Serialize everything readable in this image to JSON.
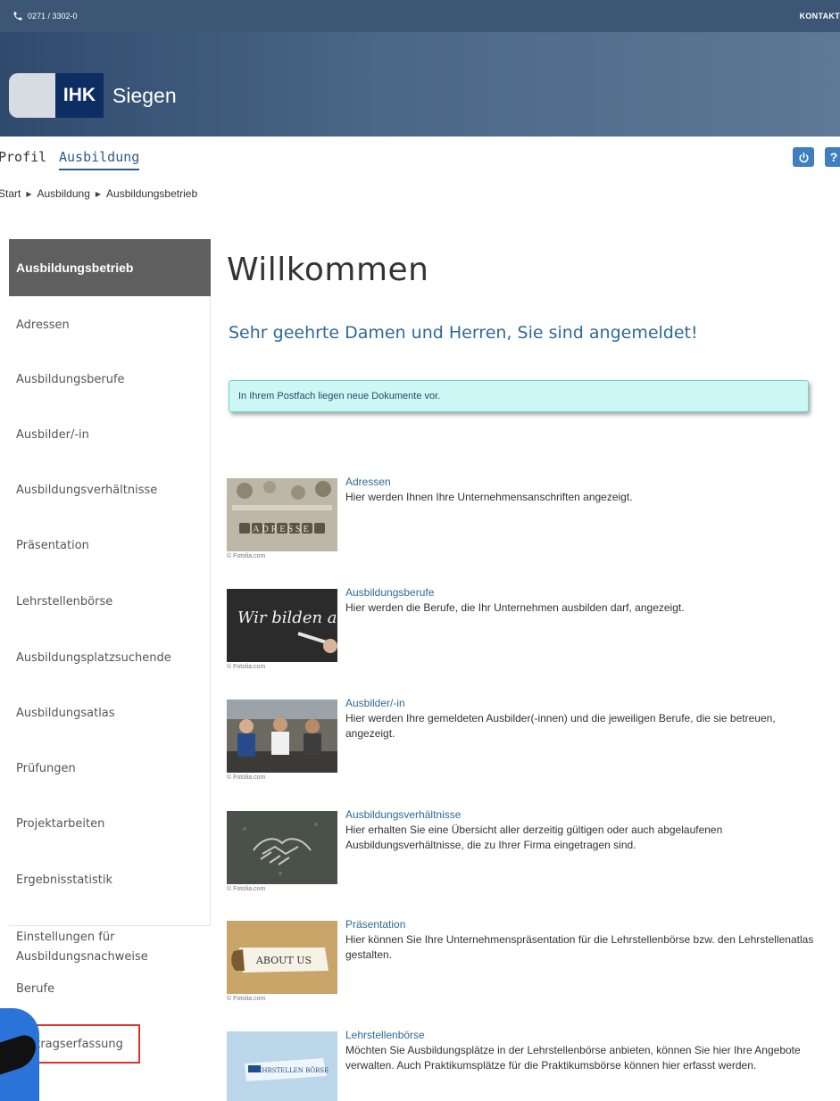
{
  "topbar": {
    "phone": "0271 / 3302-0",
    "contact": "KONTAKT"
  },
  "logo": {
    "abbr": "IHK",
    "city": "Siegen"
  },
  "nav": {
    "tabs": [
      "Profil",
      "Ausbildung"
    ],
    "power_icon": "power-icon",
    "help_label": "?"
  },
  "breadcrumb": [
    "Start",
    "Ausbildung",
    "Ausbildungsbetrieb"
  ],
  "sidebar": {
    "items": [
      "Ausbildungsbetrieb",
      "Adressen",
      "Ausbildungsberufe",
      "Ausbilder/-in",
      "Ausbildungsverhältnisse",
      "Präsentation",
      "Lehrstellenbörse",
      "Ausbildungsplatzsuchende",
      "Ausbildungsatlas",
      "Prüfungen",
      "Projektarbeiten",
      "Ergebnisstatistik",
      "Einstellungen für Ausbildungsnachweise",
      "Berufe",
      "Vertragserfassung"
    ]
  },
  "main": {
    "title": "Willkommen",
    "greeting": "Sehr geehrte Damen und Herren, Sie sind angemeldet!",
    "alert": "In Ihrem Postfach liegen neue Dokumente vor.",
    "credit": "© Fotolia.com",
    "cards": [
      {
        "title": "Adressen",
        "desc": "Hier werden Ihnen Ihre Unternehmensanschriften angezeigt.",
        "thumb_text": "ADRESSE"
      },
      {
        "title": "Ausbildungsberufe",
        "desc": "Hier werden die Berufe, die Ihr Unternehmen ausbilden darf, angezeigt.",
        "thumb_text": "Wir bilden aus!"
      },
      {
        "title": "Ausbilder/-in",
        "desc": "Hier werden Ihre gemeldeten Ausbilder(-innen) und die jeweiligen Berufe, die sie betreuen, angezeigt.",
        "thumb_text": ""
      },
      {
        "title": "Ausbildungsverhältnisse",
        "desc": "Hier erhalten Sie eine Übersicht aller derzeitig gültigen oder auch abgelaufenen Ausbildungsverhältnisse, die zu Ihrer Firma eingetragen sind.",
        "thumb_text": ""
      },
      {
        "title": "Präsentation",
        "desc": "Hier können Sie Ihre Unternehmenspräsentation für die Lehrstellenbörse bzw. den Lehrstellenatlas gestalten.",
        "thumb_text": "ABOUT US"
      },
      {
        "title": "Lehrstellenbörse",
        "desc": "Möchten Sie Ausbildungsplätze in der Lehrstellenbörse anbieten, können Sie hier Ihre Angebote verwalten. Auch Praktikumsplätze für die Praktikumsbörse können hier erfasst werden.",
        "thumb_text": "LEHRSTELLEN BÖRSE"
      }
    ]
  }
}
